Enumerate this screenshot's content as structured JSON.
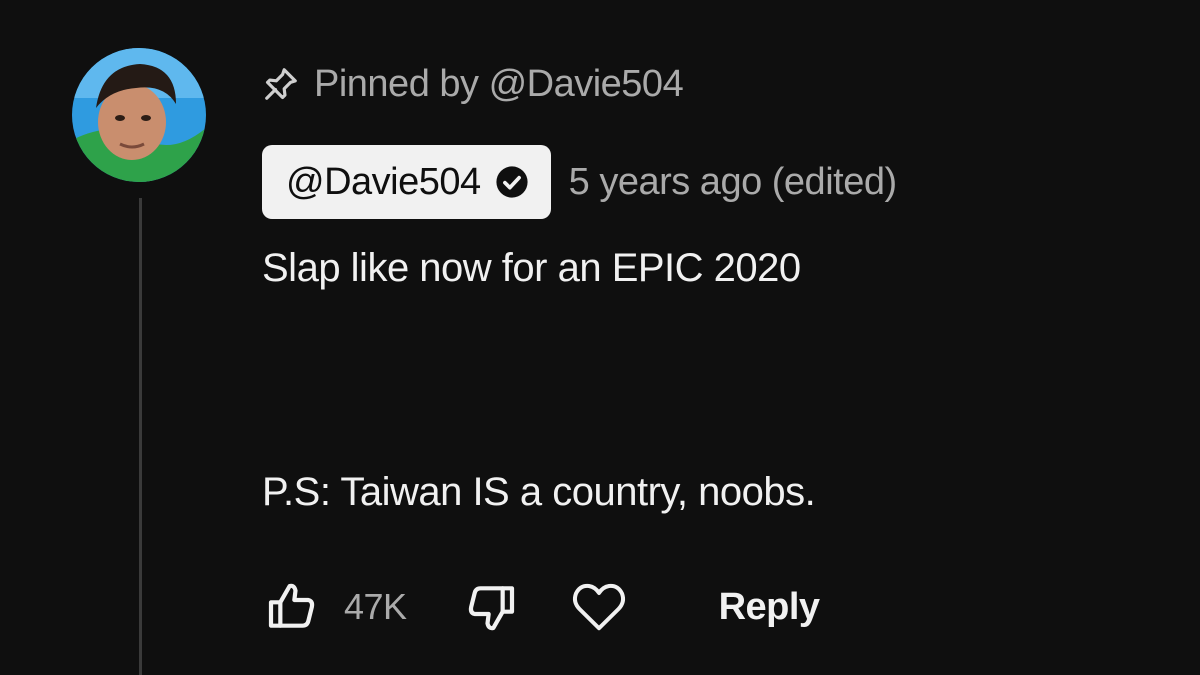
{
  "comment": {
    "pinned_label": "Pinned by @Davie504",
    "author": "@Davie504",
    "timestamp": "5 years ago (edited)",
    "text_line1": "Slap like now for an EPIC 2020",
    "text_line2": "P.S: Taiwan IS a country, noobs.",
    "like_count": "47K",
    "reply_label": "Reply"
  },
  "icons": {
    "pin": "pin-icon",
    "verified": "verified-checkmark-icon",
    "like": "thumbs-up-icon",
    "dislike": "thumbs-down-icon",
    "heart": "heart-icon"
  },
  "colors": {
    "background": "#0f0f0f",
    "primary_text": "#f1f1f1",
    "secondary_text": "#aaaaaa",
    "author_chip_bg": "#f1f1f1"
  }
}
